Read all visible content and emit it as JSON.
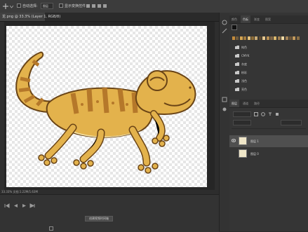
{
  "options_bar": {
    "items": [
      {
        "label": "自动选择:",
        "name": "auto-select-checkbox"
      },
      {
        "label": "图层",
        "name": "target-select"
      },
      {
        "label": "显示变换控件",
        "name": "show-transform-checkbox"
      }
    ]
  },
  "document_tab": {
    "title": "龙.png @ 33.3% (Layer 1, RGB/8)"
  },
  "status_bar": {
    "text": "33.33%   文档:1.22M/1.63M"
  },
  "timeline": {
    "button_label": "创建视频时间轴"
  },
  "panels": {
    "top_tabs": [
      "颜色",
      "色板",
      "渐变",
      "图案"
    ],
    "swatch_colors": [
      "#c38b3c",
      "#6e5a3c",
      "#d3a451",
      "#a27a3e",
      "#e2bf7a",
      "#8c6b37",
      "#c9ac76",
      "#5d4a2f",
      "#e6c88f",
      "#b88f52",
      "#7d6446",
      "#dcb96d",
      "#9b7b4f",
      "#f0d9a3",
      "#a38256",
      "#6b5538",
      "#c29a5d",
      "#8a6e44"
    ],
    "folders": [
      "纯色",
      "CMYK",
      "灰度",
      "粉彩",
      "浅色",
      "亮色"
    ],
    "layers_tabs": [
      "图层",
      "通道",
      "路径"
    ],
    "layers": [
      {
        "name": "图层 1",
        "selected": true
      },
      {
        "name": "图层 0",
        "selected": false
      }
    ]
  },
  "colors": {
    "app_bg": "#2b2b2b",
    "panel_bg": "#353535",
    "lizard_body": "#e3b24c",
    "lizard_stripe": "#b5782a",
    "lizard_belly": "#f4e2a6"
  }
}
